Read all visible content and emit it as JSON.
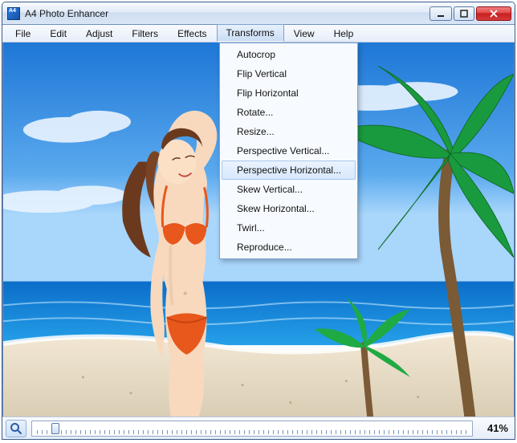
{
  "app": {
    "title": "A4 Photo Enhancer"
  },
  "menubar": {
    "items": [
      {
        "label": "File"
      },
      {
        "label": "Edit"
      },
      {
        "label": "Adjust"
      },
      {
        "label": "Filters"
      },
      {
        "label": "Effects"
      },
      {
        "label": "Transforms",
        "active": true
      },
      {
        "label": "View"
      },
      {
        "label": "Help"
      }
    ]
  },
  "dropdown": {
    "items": [
      {
        "label": "Autocrop"
      },
      {
        "label": "Flip Vertical"
      },
      {
        "label": "Flip Horizontal"
      },
      {
        "label": "Rotate..."
      },
      {
        "label": "Resize..."
      },
      {
        "label": "Perspective Vertical..."
      },
      {
        "label": "Perspective Horizontal...",
        "hovered": true
      },
      {
        "label": "Skew Vertical..."
      },
      {
        "label": "Skew Horizontal..."
      },
      {
        "label": "Twirl..."
      },
      {
        "label": "Reproduce..."
      }
    ]
  },
  "status": {
    "zoom_percent": "41%",
    "slider_position_pct": 4
  },
  "colors": {
    "titlebar_border": "#3b5b8a",
    "close_red": "#c91d1d",
    "menu_highlight": "#d7e8fb"
  }
}
